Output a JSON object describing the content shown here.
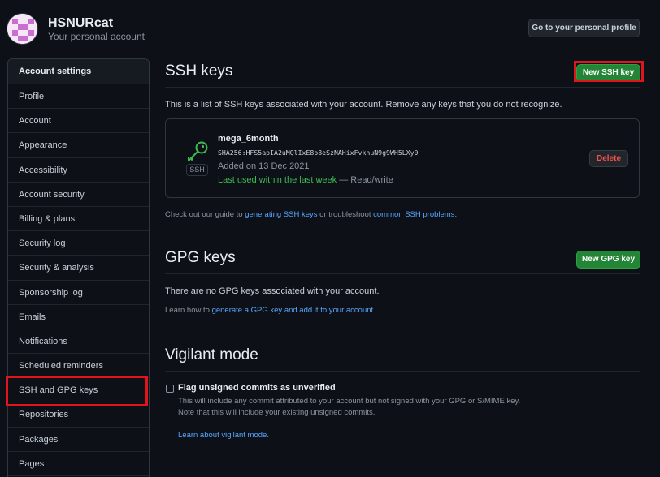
{
  "user": {
    "name": "HSNURcat",
    "subtitle": "Your personal account",
    "profile_button": "Go to your personal profile"
  },
  "sidebar": {
    "heading": "Account settings",
    "items": [
      {
        "label": "Profile"
      },
      {
        "label": "Account"
      },
      {
        "label": "Appearance"
      },
      {
        "label": "Accessibility"
      },
      {
        "label": "Account security"
      },
      {
        "label": "Billing & plans"
      },
      {
        "label": "Security log"
      },
      {
        "label": "Security & analysis"
      },
      {
        "label": "Sponsorship log"
      },
      {
        "label": "Emails"
      },
      {
        "label": "Notifications"
      },
      {
        "label": "Scheduled reminders"
      },
      {
        "label": "SSH and GPG keys"
      },
      {
        "label": "Repositories"
      },
      {
        "label": "Packages"
      },
      {
        "label": "Pages"
      }
    ],
    "selected": "SSH and GPG keys"
  },
  "ssh": {
    "title": "SSH keys",
    "new_button": "New SSH key",
    "description": "This is a list of SSH keys associated with your account. Remove any keys that you do not recognize.",
    "key": {
      "name": "mega_6month",
      "fingerprint": "SHA256:HFS5apIA2uMQlIxE8b8eSzNAHixFvknuN9g9WH5LXy0",
      "added": "Added on 13 Dec 2021",
      "last_used": "Last used within the last week",
      "access": "— Read/write",
      "badge": "SSH",
      "delete_button": "Delete"
    },
    "guide": {
      "prefix": "Check out our guide to",
      "link1": "generating SSH keys",
      "middle": "or troubleshoot",
      "link2": "common SSH problems",
      "suffix": "."
    }
  },
  "gpg": {
    "title": "GPG keys",
    "new_button": "New GPG key",
    "empty_text": "There are no GPG keys associated with your account.",
    "learn_prefix": "Learn how to",
    "learn_link": "generate a GPG key and add it to your account",
    "learn_suffix": "."
  },
  "vigilant": {
    "title": "Vigilant mode",
    "checkbox_label": "Flag unsigned commits as unverified",
    "help_line1": "This will include any commit attributed to your account but not signed with your GPG or S/MIME key.",
    "help_line2": "Note that this will include your existing unsigned commits.",
    "learn_link": "Learn about vigilant mode."
  },
  "colors": {
    "background": "#0d1117",
    "accent_green": "#238636",
    "link_blue": "#58a6ff",
    "danger_red": "#f85149",
    "highlight_red": "#e0141b"
  },
  "icons": {
    "key": "key-icon",
    "avatar": "identicon-avatar"
  }
}
